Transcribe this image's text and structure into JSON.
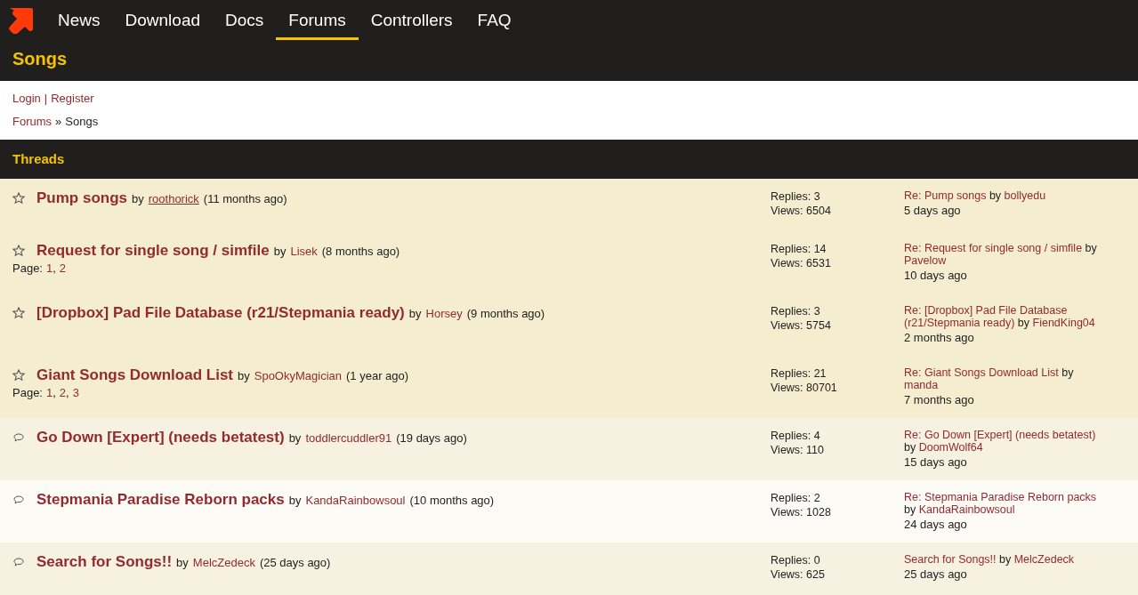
{
  "nav": {
    "items": [
      {
        "label": "News",
        "selected": false
      },
      {
        "label": "Download",
        "selected": false
      },
      {
        "label": "Docs",
        "selected": false
      },
      {
        "label": "Forums",
        "selected": true
      },
      {
        "label": "Controllers",
        "selected": false
      },
      {
        "label": "FAQ",
        "selected": false
      }
    ]
  },
  "page_title": "Songs",
  "account_links": {
    "login": "Login",
    "separator": "|",
    "register": "Register"
  },
  "breadcrumb": {
    "parent": "Forums",
    "separator": "»",
    "current": "Songs"
  },
  "threads_header": "Threads",
  "page_separator": ",",
  "threads": [
    {
      "kind": "sticky",
      "title": "Pump songs",
      "by": "by",
      "author": "roothorick",
      "author_hovered": true,
      "age": "(11 months ago)",
      "replies": "Replies: 3",
      "views": "Views: 6504",
      "last_post": {
        "link": "Re: Pump songs",
        "by": "by",
        "author": "bollyedu",
        "age": "5 days ago"
      }
    },
    {
      "kind": "sticky",
      "title": "Request for single song / simfile",
      "by": "by",
      "author": "Lisek",
      "author_hovered": false,
      "age": "(8 months ago)",
      "page_label": "Page:",
      "pages": [
        "1",
        "2"
      ],
      "replies": "Replies: 14",
      "views": "Views: 6531",
      "last_post": {
        "link": "Re: Request for single song / simfile",
        "by": "by",
        "author": "Pavelow",
        "age": "10 days ago"
      }
    },
    {
      "kind": "sticky",
      "title": "[Dropbox] Pad File Database (r21/Stepmania ready)",
      "by": "by",
      "author": "Horsey",
      "author_hovered": false,
      "age": "(9 months ago)",
      "replies": "Replies: 3",
      "views": "Views: 5754",
      "last_post": {
        "link": "Re: [Dropbox] Pad File Database (r21/Stepmania ready)",
        "by": "by",
        "author": "FiendKing04",
        "age": "2 months ago"
      }
    },
    {
      "kind": "sticky",
      "title": "Giant Songs Download List",
      "by": "by",
      "author": "SpoOkyMagician",
      "author_hovered": false,
      "age": "(1 year ago)",
      "page_label": "Page:",
      "pages": [
        "1",
        "2",
        "3"
      ],
      "replies": "Replies: 21",
      "views": "Views: 80701",
      "last_post": {
        "link": "Re: Giant Songs Download List",
        "by": "by",
        "author": "manda",
        "age": "7 months ago"
      }
    },
    {
      "kind": "normal",
      "title": "Go Down [Expert] (needs betatest)",
      "by": "by",
      "author": "toddlercuddler91",
      "author_hovered": false,
      "age": "(19 days ago)",
      "replies": "Replies: 4",
      "views": "Views: 110",
      "last_post": {
        "link": "Re: Go Down [Expert] (needs betatest)",
        "by": "by",
        "author": "DoomWolf64",
        "age": "15 days ago"
      }
    },
    {
      "kind": "normal",
      "title": "Stepmania Paradise Reborn packs",
      "by": "by",
      "author": "KandaRainbowsoul",
      "author_hovered": false,
      "age": "(10 months ago)",
      "replies": "Replies: 2",
      "views": "Views: 1028",
      "last_post": {
        "link": "Re: Stepmania Paradise Reborn packs",
        "by": "by",
        "author": "KandaRainbowsoul",
        "age": "24 days ago"
      }
    },
    {
      "kind": "normal",
      "title": "Search for Songs!!",
      "by": "by",
      "author": "MelcZedeck",
      "author_hovered": false,
      "age": "(25 days ago)",
      "replies": "Replies: 0",
      "views": "Views: 625",
      "last_post": {
        "link": "Search for Songs!!",
        "by": "by",
        "author": "MelcZedeck",
        "age": "25 days ago"
      }
    }
  ]
}
